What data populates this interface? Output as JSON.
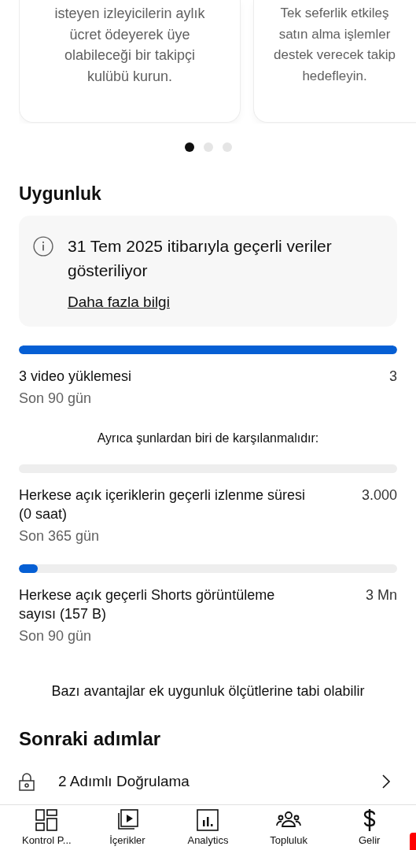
{
  "carousel": {
    "cards": [
      {
        "text": "isteyen izleyicilerin aylık\nücret ödeyerek üye\nolabileceği bir takipçi\nkulübü kurun."
      },
      {
        "text": "Tek seferlik etkileş\nsatın alma işlemler\ndestek verecek takip\nhedefleyin."
      }
    ],
    "dots": [
      {
        "selected": true
      },
      {
        "selected": false
      },
      {
        "selected": false
      }
    ]
  },
  "eligibility": {
    "title": "Uygunluk",
    "notice": {
      "text": "31 Tem 2025 itibarıyla geçerli veriler gösteriliyor",
      "link": "Daha fazla bilgi"
    },
    "requirements": [
      {
        "level": 1,
        "label": "3 video yüklemesi",
        "target": "3",
        "period": "Son 90 gün"
      }
    ],
    "also_note": "Ayrıca şunlardan biri de karşılanmalıdır:",
    "alternatives": [
      {
        "label": "Herkese açık içeriklerin geçerli izlenme süresi (0 saat)",
        "target": "3.000",
        "period": "Son 365 gün"
      },
      {
        "level": 0.05,
        "label": "Herkese açık geçerli Shorts görüntüleme sayısı (157 B)",
        "target": "3 Mn",
        "period": "Son 90 gün"
      }
    ],
    "footnote": "Bazı avantajlar ek uygunluk ölçütlerine tabi olabilir"
  },
  "next_steps": {
    "title": "Sonraki adımlar",
    "items": [
      {
        "label": "2 Adımlı Doğrulama"
      }
    ]
  },
  "bottom_nav": [
    {
      "kind": "dashboard",
      "label": "Kontrol P..."
    },
    {
      "kind": "content",
      "label": "İçerikler"
    },
    {
      "kind": "analytics",
      "label": "Analytics"
    },
    {
      "kind": "community",
      "label": "Topluluk"
    },
    {
      "kind": "earn",
      "label": "Gelir"
    }
  ]
}
